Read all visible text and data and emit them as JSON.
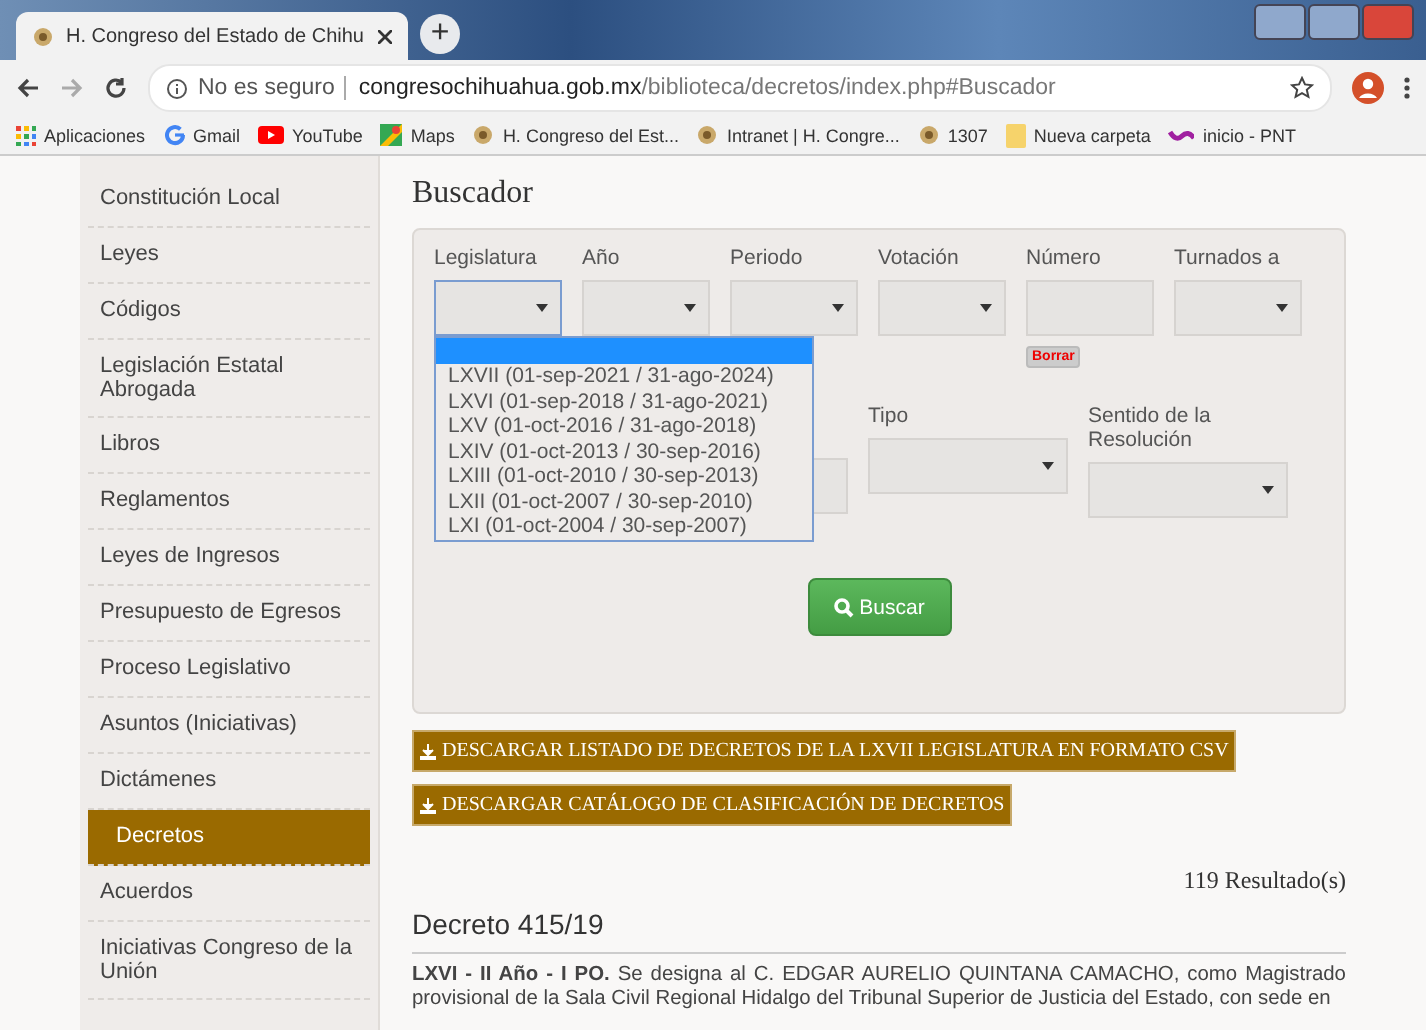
{
  "browser": {
    "tab_title": "H. Congreso del Estado de Chihu",
    "new_tab": "+",
    "security": "No es seguro",
    "url_host": "congresochihuahua.gob.mx",
    "url_path": "/biblioteca/decretos/index.php#Buscador",
    "bookmarks": [
      {
        "label": "Aplicaciones",
        "kind": "apps"
      },
      {
        "label": "Gmail",
        "kind": "google"
      },
      {
        "label": "YouTube",
        "kind": "youtube"
      },
      {
        "label": "Maps",
        "kind": "maps"
      },
      {
        "label": "H. Congreso del Est...",
        "kind": "seal"
      },
      {
        "label": "Intranet | H. Congre...",
        "kind": "seal"
      },
      {
        "label": "1307",
        "kind": "seal"
      },
      {
        "label": "Nueva carpeta",
        "kind": "folder"
      },
      {
        "label": "inicio - PNT",
        "kind": "pnt"
      }
    ]
  },
  "sidebar": {
    "items": [
      {
        "label": "Constitución Local",
        "selected": false
      },
      {
        "label": "Leyes",
        "selected": false
      },
      {
        "label": "Códigos",
        "selected": false
      },
      {
        "label": "Legislación Estatal Abrogada",
        "selected": false
      },
      {
        "label": "Libros",
        "selected": false
      },
      {
        "label": "Reglamentos",
        "selected": false
      },
      {
        "label": "Leyes de Ingresos",
        "selected": false
      },
      {
        "label": "Presupuesto de Egresos",
        "selected": false
      },
      {
        "label": "Proceso Legislativo",
        "selected": false
      },
      {
        "label": "Asuntos (Iniciativas)",
        "selected": false
      },
      {
        "label": "Dictámenes",
        "selected": false
      },
      {
        "label": "Decretos",
        "selected": true
      },
      {
        "label": "Acuerdos",
        "selected": false
      },
      {
        "label": "Iniciativas Congreso de la Unión",
        "selected": false
      }
    ]
  },
  "search": {
    "title": "Buscador",
    "row_1": [
      {
        "label": "Legislatura",
        "kind": "select"
      },
      {
        "label": "Año",
        "kind": "select"
      },
      {
        "label": "Periodo",
        "kind": "select"
      },
      {
        "label": "Votación",
        "kind": "select"
      },
      {
        "label": "Número",
        "kind": "input",
        "clear": "Borrar"
      },
      {
        "label": "Turnados a",
        "kind": "select"
      }
    ],
    "row_2": [
      {
        "label": "Tipo",
        "kind": "select"
      },
      {
        "label": "Sentido de la Resolución",
        "kind": "select"
      }
    ],
    "dropdown": {
      "options": [
        "LXVII (01-sep-2021 / 31-ago-2024)",
        "LXVI (01-sep-2018 / 31-ago-2021)",
        "LXV (01-oct-2016 / 31-ago-2018)",
        "LXIV (01-oct-2013 / 30-sep-2016)",
        "LXIII (01-oct-2010 / 30-sep-2013)",
        "LXII (01-oct-2007 / 30-sep-2010)",
        "LXI (01-oct-2004 / 30-sep-2007)"
      ]
    },
    "submit": "Buscar"
  },
  "downloads": [
    "DESCARGAR LISTADO DE DECRETOS DE LA LXVII LEGISLATURA EN FORMATO CSV",
    "DESCARGAR CATÁLOGO DE CLASIFICACIÓN DE DECRETOS"
  ],
  "results": {
    "count": "119 Resultado(s)",
    "title": "Decreto 415/19",
    "text": "**LXVI - II Año - I PO.** Se designa al C. EDGAR AURELIO QUINTANA CAMACHO, como Magistrado provisional de la Sala Civil Regional Hidalgo del Tribunal Superior de Justicia del Estado, con sede en"
  }
}
